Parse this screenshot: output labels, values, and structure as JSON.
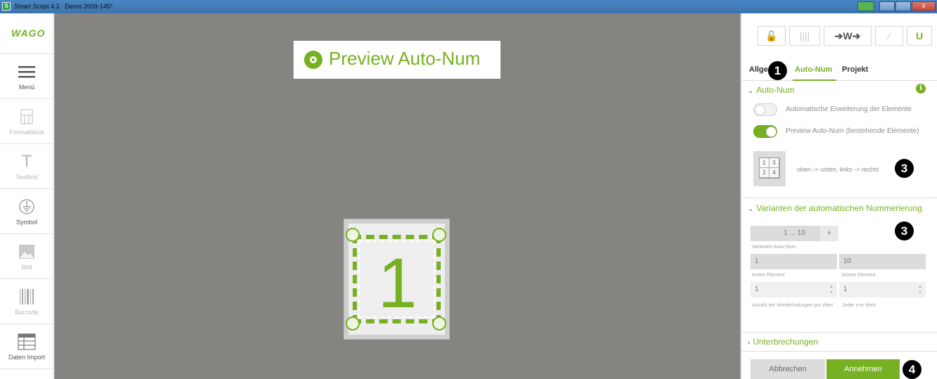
{
  "window": {
    "app_title": "Smart Script 4.2",
    "document_title": "Demo 2009-145*",
    "close_glyph": "x"
  },
  "sidebar": {
    "logo_text": "WAGO",
    "items": [
      {
        "label": "Menü",
        "icon": "menu-icon",
        "enabled": true
      },
      {
        "label": "Formatblock",
        "icon": "format-block-icon",
        "enabled": false
      },
      {
        "label": "Textfeld",
        "icon": "text-field-icon",
        "glyph": "T",
        "enabled": false
      },
      {
        "label": "Symbol",
        "icon": "ground-symbol-icon",
        "enabled": true
      },
      {
        "label": "Bild",
        "icon": "image-icon",
        "enabled": false
      },
      {
        "label": "Barcode",
        "icon": "barcode-icon",
        "enabled": false
      },
      {
        "label": "Daten Import",
        "icon": "data-import-icon",
        "enabled": true
      }
    ]
  },
  "canvas": {
    "preview_banner": "Preview Auto-Num",
    "label_number": "1"
  },
  "panel": {
    "toolbar": {
      "lock_glyph": "🔓",
      "columns_glyph": "||||",
      "width_glyph": "➔W➔",
      "wand_glyph": "⁄",
      "magnet_glyph": "U"
    },
    "tabs": [
      {
        "label": "Allgemein",
        "visible_label": "Allge",
        "active": false
      },
      {
        "label": "Auto-Num",
        "active": true
      },
      {
        "label": "Projekt",
        "active": false
      }
    ],
    "autonum_section": {
      "title": "Auto-Num",
      "info_glyph": "i",
      "toggle1_label": "Automatische Erweiterung der Elemente",
      "toggle1_on": false,
      "toggle2_label": "Preview Auto-Num (bestehende Elemente)",
      "toggle2_on": true,
      "order_grid": [
        "1",
        "3",
        "2",
        "4"
      ],
      "order_text": "oben -> unten, links -> rechts"
    },
    "variants_section": {
      "title": "Varianten der automatischen Nummerierung",
      "select_value": "1 ... 10",
      "select_arrow": "▼",
      "select_caption": "Varianten Auto-Num",
      "first_value": "1",
      "first_caption": "erstes Element",
      "last_value": "10",
      "last_caption": "letztes Element",
      "repeat_value": "1",
      "repeat_caption": "Anzahl der Wiederholungen pro Wert",
      "nth_value": "1",
      "nth_caption": "Jeder x-te Wert",
      "spin_up": "▲",
      "spin_down": "▼"
    },
    "breaks_section": {
      "title": "Unterbrechungen"
    },
    "buttons": {
      "cancel": "Abbrechen",
      "ok": "Annehmen"
    },
    "chevrons": {
      "open": "⌄",
      "closed": "›"
    }
  },
  "callouts": [
    "1",
    "3",
    "3",
    "4"
  ],
  "colors": {
    "accent": "#77b022",
    "canvas_bg": "#858480",
    "titlebar": "#4a86c4"
  }
}
